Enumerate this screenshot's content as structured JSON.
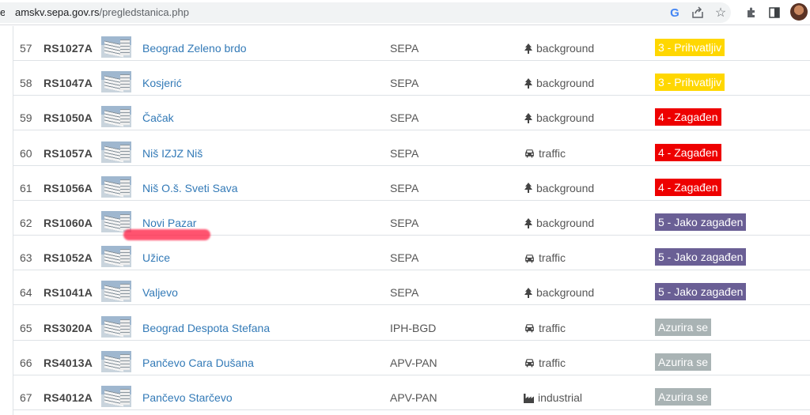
{
  "browser": {
    "url_cut_letter": "e",
    "url_host": "amskv.sepa.gov.rs",
    "url_path": "/pregledstanica.php"
  },
  "colors": {
    "badge_3": "#ffd700",
    "badge_4": "#ee0000",
    "badge_5": "#6a5f95",
    "badge_updating": "#a9b3b4",
    "link": "#337ab7"
  },
  "rows": [
    {
      "num": "57",
      "code": "RS1027A",
      "name": "Beograd Zeleno brdo",
      "network": "SEPA",
      "type_icon": "tree-icon",
      "type": "background",
      "badge": "3 - Prihvatljiv",
      "badge_color": "#ffd700"
    },
    {
      "num": "58",
      "code": "RS1047A",
      "name": "Kosjerić",
      "network": "SEPA",
      "type_icon": "tree-icon",
      "type": "background",
      "badge": "3 - Prihvatljiv",
      "badge_color": "#ffd700"
    },
    {
      "num": "59",
      "code": "RS1050A",
      "name": "Čačak",
      "network": "SEPA",
      "type_icon": "tree-icon",
      "type": "background",
      "badge": "4 - Zagađen",
      "badge_color": "#ee0000"
    },
    {
      "num": "60",
      "code": "RS1057A",
      "name": "Niš IZJZ Niš",
      "network": "SEPA",
      "type_icon": "car-icon",
      "type": "traffic",
      "badge": "4 - Zagađen",
      "badge_color": "#ee0000"
    },
    {
      "num": "61",
      "code": "RS1056A",
      "name": "Niš O.š. Sveti Sava",
      "network": "SEPA",
      "type_icon": "tree-icon",
      "type": "background",
      "badge": "4 - Zagađen",
      "badge_color": "#ee0000"
    },
    {
      "num": "62",
      "code": "RS1060A",
      "name": "Novi Pazar",
      "network": "SEPA",
      "type_icon": "tree-icon",
      "type": "background",
      "badge": "5 - Jako zagađen",
      "badge_color": "#6a5f95"
    },
    {
      "num": "63",
      "code": "RS1052A",
      "name": "Užice",
      "network": "SEPA",
      "type_icon": "car-icon",
      "type": "traffic",
      "badge": "5 - Jako zagađen",
      "badge_color": "#6a5f95"
    },
    {
      "num": "64",
      "code": "RS1041A",
      "name": "Valjevo",
      "network": "SEPA",
      "type_icon": "tree-icon",
      "type": "background",
      "badge": "5 - Jako zagađen",
      "badge_color": "#6a5f95"
    },
    {
      "num": "65",
      "code": "RS3020A",
      "name": "Beograd Despota Stefana",
      "network": "IPH-BGD",
      "type_icon": "car-icon",
      "type": "traffic",
      "badge": "Azurira se",
      "badge_color": "#a9b3b4"
    },
    {
      "num": "66",
      "code": "RS4013A",
      "name": "Pančevo Cara Dušana",
      "network": "APV-PAN",
      "type_icon": "car-icon",
      "type": "traffic",
      "badge": "Azurira se",
      "badge_color": "#a9b3b4"
    },
    {
      "num": "67",
      "code": "RS4012A",
      "name": "Pančevo Starčevo",
      "network": "APV-PAN",
      "type_icon": "industry-icon",
      "type": "industrial",
      "badge": "Azurira se",
      "badge_color": "#a9b3b4"
    }
  ]
}
